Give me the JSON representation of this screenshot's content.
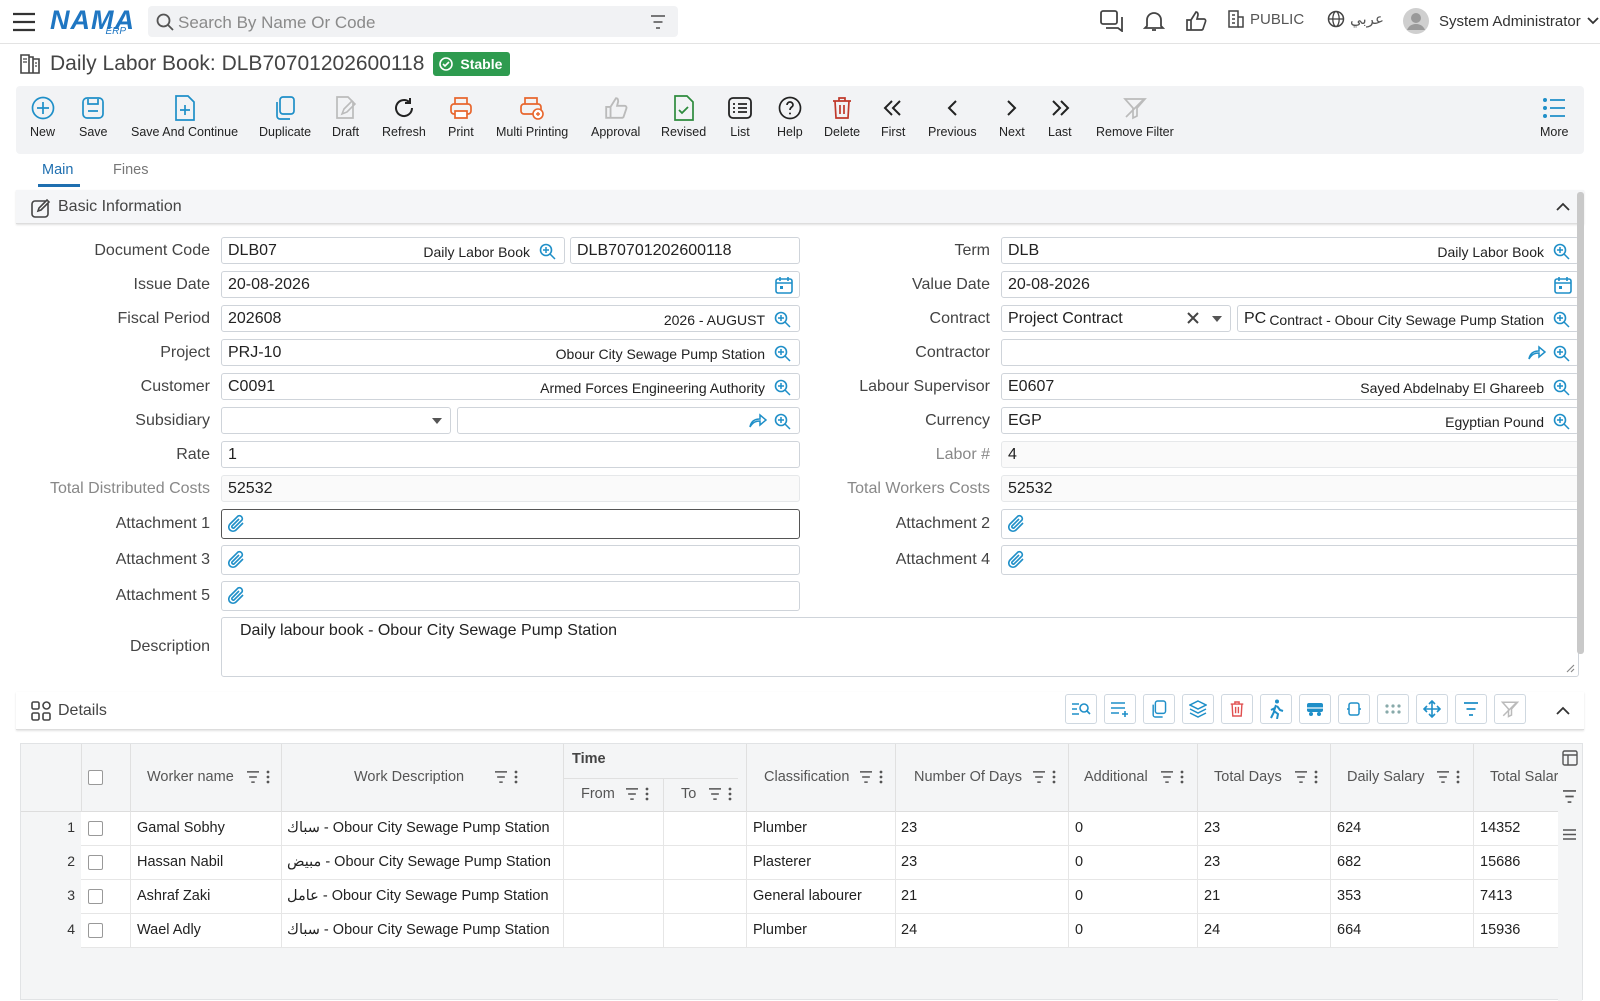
{
  "header": {
    "logo_text": "NAMA",
    "logo_sub": "ERP",
    "search_placeholder": "Search By Name Or Code",
    "public_label": "PUBLIC",
    "lang_label": "عربي",
    "user_name": "System Administrator"
  },
  "page": {
    "title": "Daily Labor Book: DLB70701202600118",
    "status": "Stable"
  },
  "toolbar": {
    "buttons": [
      "New",
      "Save",
      "Save And Continue",
      "Duplicate",
      "Draft",
      "Refresh",
      "Print",
      "Multi Printing",
      "Approval",
      "Revised",
      "List",
      "Help",
      "Delete",
      "First",
      "Previous",
      "Next",
      "Last",
      "Remove Filter",
      "More"
    ]
  },
  "tabs": [
    "Main",
    "Fines"
  ],
  "basic": {
    "section_title": "Basic Information",
    "document_code": {
      "label": "Document Code",
      "code": "DLB07",
      "desc": "Daily Labor Book",
      "number": "DLB70701202600118"
    },
    "term": {
      "label": "Term",
      "code": "DLB",
      "desc": "Daily Labor Book"
    },
    "issue_date": {
      "label": "Issue Date",
      "value": "20-08-2026"
    },
    "value_date": {
      "label": "Value Date",
      "value": "20-08-2026"
    },
    "fiscal_period": {
      "label": "Fiscal Period",
      "code": "202608",
      "desc": "2026 - AUGUST"
    },
    "contract": {
      "label": "Contract",
      "type": "Project Contract",
      "code": "PC",
      "desc": "Contract - Obour City Sewage Pump Station"
    },
    "project": {
      "label": "Project",
      "code": "PRJ-10",
      "desc": "Obour City Sewage Pump Station"
    },
    "contractor": {
      "label": "Contractor"
    },
    "customer": {
      "label": "Customer",
      "code": "C0091",
      "desc": "Armed Forces Engineering Authority"
    },
    "labour_supervisor": {
      "label": "Labour Supervisor",
      "code": "E0607",
      "desc": "Sayed Abdelnaby El Ghareeb"
    },
    "subsidiary": {
      "label": "Subsidiary"
    },
    "currency": {
      "label": "Currency",
      "code": "EGP",
      "desc": "Egyptian Pound"
    },
    "rate": {
      "label": "Rate",
      "value": "1"
    },
    "labor_no": {
      "label": "Labor #",
      "value": "4"
    },
    "total_distributed": {
      "label": "Total Distributed Costs",
      "value": "52532"
    },
    "total_workers": {
      "label": "Total Workers Costs",
      "value": "52532"
    },
    "attachment1": {
      "label": "Attachment 1"
    },
    "attachment2": {
      "label": "Attachment 2"
    },
    "attachment3": {
      "label": "Attachment 3"
    },
    "attachment4": {
      "label": "Attachment 4"
    },
    "attachment5": {
      "label": "Attachment 5"
    },
    "description": {
      "label": "Description",
      "value": "Daily labour book - Obour City Sewage Pump Station"
    }
  },
  "details": {
    "section_title": "Details",
    "columns": {
      "worker_name": "Worker name",
      "work_description": "Work Description",
      "time": "Time",
      "from": "From",
      "to": "To",
      "classification": "Classification",
      "number_of_days": "Number Of Days",
      "additional": "Additional",
      "total_days": "Total Days",
      "daily_salary": "Daily Salary",
      "total_salary": "Total Salar"
    },
    "rows": [
      {
        "n": "1",
        "worker": "Gamal Sobhy",
        "work": "سباك - Obour City Sewage Pump Station",
        "from": "",
        "to": "",
        "class": "Plumber",
        "days": "23",
        "additional": "0",
        "total_days": "23",
        "daily": "624",
        "total": "14352"
      },
      {
        "n": "2",
        "worker": "Hassan Nabil",
        "work": "مبيض - Obour City Sewage Pump Station",
        "from": "",
        "to": "",
        "class": "Plasterer",
        "days": "23",
        "additional": "0",
        "total_days": "23",
        "daily": "682",
        "total": "15686"
      },
      {
        "n": "3",
        "worker": "Ashraf Zaki",
        "work": "عامل - Obour City Sewage Pump Station",
        "from": "",
        "to": "",
        "class": "General labourer",
        "days": "21",
        "additional": "0",
        "total_days": "21",
        "daily": "353",
        "total": "7413"
      },
      {
        "n": "4",
        "worker": "Wael Adly",
        "work": "سباك - Obour City Sewage Pump Station",
        "from": "",
        "to": "",
        "class": "Plumber",
        "days": "24",
        "additional": "0",
        "total_days": "24",
        "daily": "664",
        "total": "15936"
      }
    ]
  },
  "colors": {
    "accent": "#1f76c2",
    "stable": "#2e9b4f",
    "print": "#e8662d",
    "draft": "#bbbbbb",
    "delete": "#c0392b",
    "revised": "#2e8b3d",
    "icon_blue": "#1f8fc8"
  }
}
